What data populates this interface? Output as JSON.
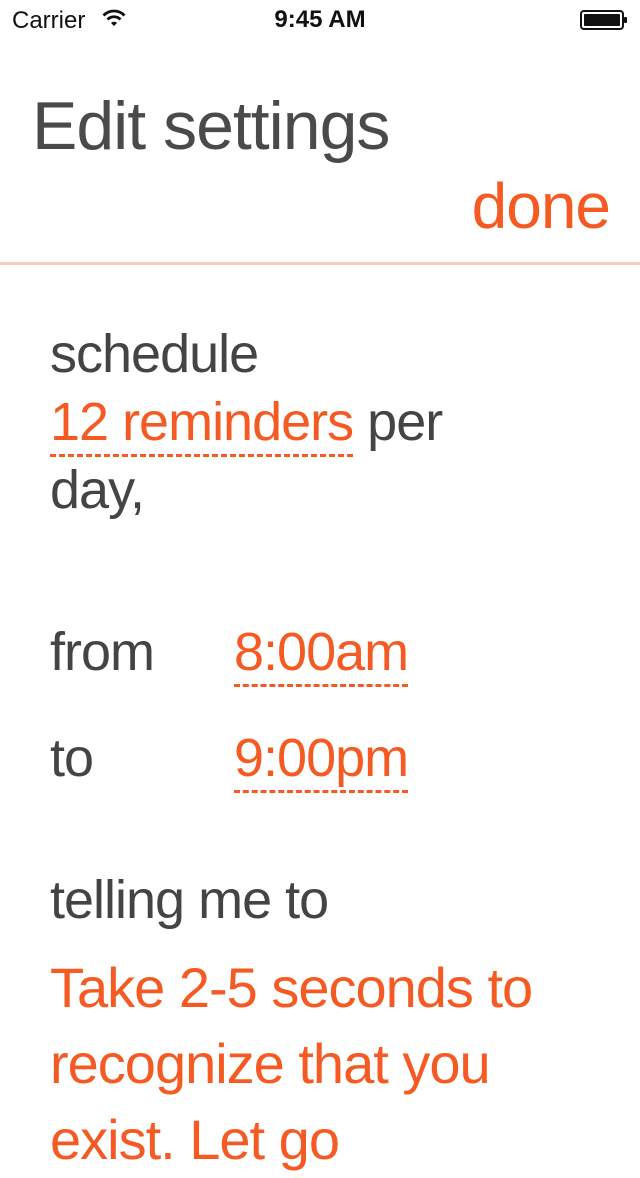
{
  "status_bar": {
    "carrier": "Carrier",
    "time": "9:45 AM"
  },
  "header": {
    "title": "Edit settings",
    "done_label": "done"
  },
  "schedule": {
    "label": "schedule",
    "reminders": "12 reminders",
    "per": "per",
    "day": "day,"
  },
  "times": {
    "from_label": "from",
    "from_value": "8:00am",
    "to_label": "to",
    "to_value": "9:00pm"
  },
  "message": {
    "label": "telling me to",
    "text": "Take 2-5 seconds to recognize that you exist. Let go"
  },
  "colors": {
    "accent": "#f55a23",
    "text": "#444444",
    "divider": "#f6cdb8"
  }
}
